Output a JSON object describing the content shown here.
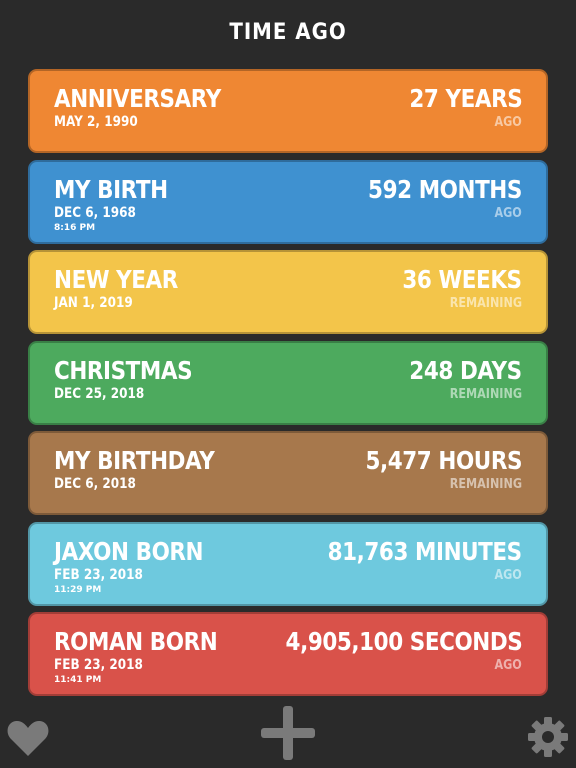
{
  "header": {
    "title": "TIME AGO"
  },
  "events": [
    {
      "name": "ANNIVERSARY",
      "date": "MAY 2, 1990",
      "time": "",
      "amount": "27 YEARS",
      "relation": "AGO",
      "color": "#ef8733"
    },
    {
      "name": "MY BIRTH",
      "date": "DEC 6, 1968",
      "time": "8:16 PM",
      "amount": "592 MONTHS",
      "relation": "AGO",
      "color": "#3f91d0"
    },
    {
      "name": "NEW YEAR",
      "date": "JAN 1, 2019",
      "time": "",
      "amount": "36 WEEKS",
      "relation": "REMAINING",
      "color": "#f3c54a"
    },
    {
      "name": "CHRISTMAS",
      "date": "DEC 25, 2018",
      "time": "",
      "amount": "248 DAYS",
      "relation": "REMAINING",
      "color": "#4daa5e"
    },
    {
      "name": "MY BIRTHDAY",
      "date": "DEC 6, 2018",
      "time": "",
      "amount": "5,477 HOURS",
      "relation": "REMAINING",
      "color": "#a7784c"
    },
    {
      "name": "JAXON BORN",
      "date": "FEB 23, 2018",
      "time": "11:29 PM",
      "amount": "81,763 MINUTES",
      "relation": "AGO",
      "color": "#6ec9de"
    },
    {
      "name": "ROMAN BORN",
      "date": "FEB 23, 2018",
      "time": "11:41 PM",
      "amount": "4,905,100 SECONDS",
      "relation": "AGO",
      "color": "#d9524a"
    }
  ],
  "toolbar": {
    "favorite_icon": "heart-icon",
    "add_icon": "plus-icon",
    "settings_icon": "gear-icon",
    "icon_color": "#7a7a7a"
  }
}
